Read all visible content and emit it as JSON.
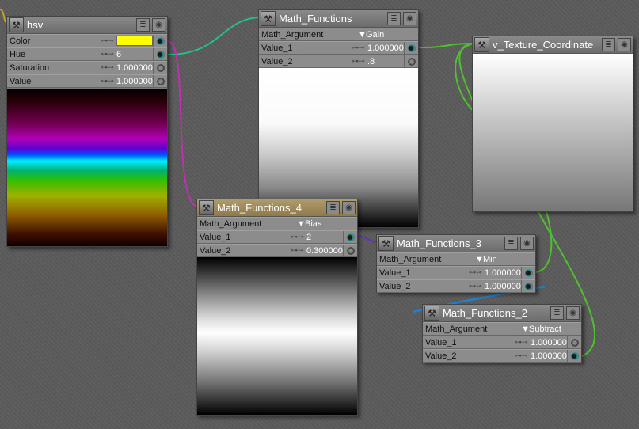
{
  "nodes": [
    {
      "id": "n-hsv",
      "title": "hsv",
      "rows": [
        {
          "label": "Color",
          "swatch": "#ffff00",
          "socket": true
        },
        {
          "label": "Hue",
          "value": "6",
          "socket": true
        },
        {
          "label": "Saturation",
          "value": "1.000000",
          "socket": false
        },
        {
          "label": "Value",
          "value": "1.000000",
          "socket": false
        }
      ],
      "preview": true
    },
    {
      "id": "n-mf",
      "title": "Math_Functions",
      "argument": {
        "label": "Math_Argument",
        "value": "Gain"
      },
      "rows": [
        {
          "label": "Value_1",
          "value": "1.000000",
          "socket": true
        },
        {
          "label": "Value_2",
          "value": ".8",
          "socket": false
        }
      ],
      "preview": true
    },
    {
      "id": "n-vt",
      "title": "v_Texture_Coordinate",
      "rows": [],
      "preview": true
    },
    {
      "id": "n-mf4",
      "title": "Math_Functions_4",
      "tan": true,
      "argument": {
        "label": "Math_Argument",
        "value": "Bias"
      },
      "rows": [
        {
          "label": "Value_1",
          "value": "2",
          "socket": true
        },
        {
          "label": "Value_2",
          "value": "0.300000",
          "socket": false
        }
      ],
      "preview": true
    },
    {
      "id": "n-mf3",
      "title": "Math_Functions_3",
      "argument": {
        "label": "Math_Argument",
        "value": "Min"
      },
      "rows": [
        {
          "label": "Value_1",
          "value": "1.000000",
          "socket": true
        },
        {
          "label": "Value_2",
          "value": "1.000000",
          "socket": true
        }
      ]
    },
    {
      "id": "n-mf2",
      "title": "Math_Functions_2",
      "argument": {
        "label": "Math_Argument",
        "value": "Subtract"
      },
      "rows": [
        {
          "label": "Value_1",
          "value": "1.000000",
          "socket": false
        },
        {
          "label": "Value_2",
          "value": "1.000000",
          "socket": true
        }
      ]
    }
  ],
  "wire_colors": {
    "yellow": "#c8a020",
    "teal": "#20c090",
    "magenta": "#c030b0",
    "green": "#50c030",
    "purple": "#6030c0",
    "blue": "#2080d0"
  }
}
